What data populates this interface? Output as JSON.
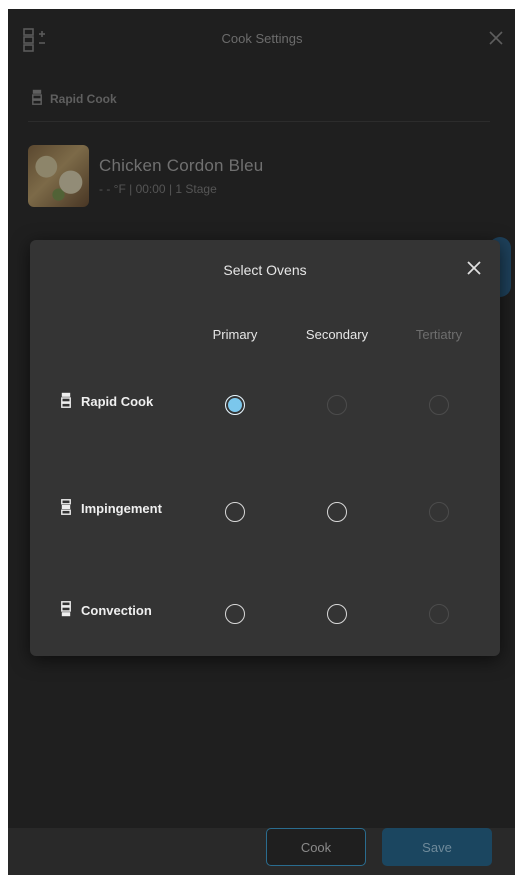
{
  "header": {
    "title": "Cook Settings"
  },
  "background": {
    "oven_label": "Rapid Cook",
    "recipe": {
      "name": "Chicken Cordon Bleu",
      "meta": "- - °F | 00:00 | 1 Stage"
    }
  },
  "dialog": {
    "title": "Select Ovens",
    "columns": [
      {
        "label": "Primary",
        "enabled": true
      },
      {
        "label": "Secondary",
        "enabled": true
      },
      {
        "label": "Tertiatry",
        "enabled": false
      }
    ],
    "rows": [
      {
        "label": "Rapid Cook",
        "options": [
          "selected",
          "disabled",
          "disabled"
        ]
      },
      {
        "label": "Impingement",
        "options": [
          "enabled",
          "enabled",
          "disabled"
        ]
      },
      {
        "label": "Convection",
        "options": [
          "enabled",
          "enabled",
          "disabled"
        ]
      }
    ]
  },
  "footer": {
    "cook_label": "Cook",
    "save_label": "Save"
  },
  "colors": {
    "accent": "#7bc7ec",
    "dialog_bg": "#343434",
    "screen_bg": "#1f1f1f"
  },
  "icons": {
    "add": "add-oven-icon",
    "oven": "oven-icon",
    "close": "close-icon"
  }
}
